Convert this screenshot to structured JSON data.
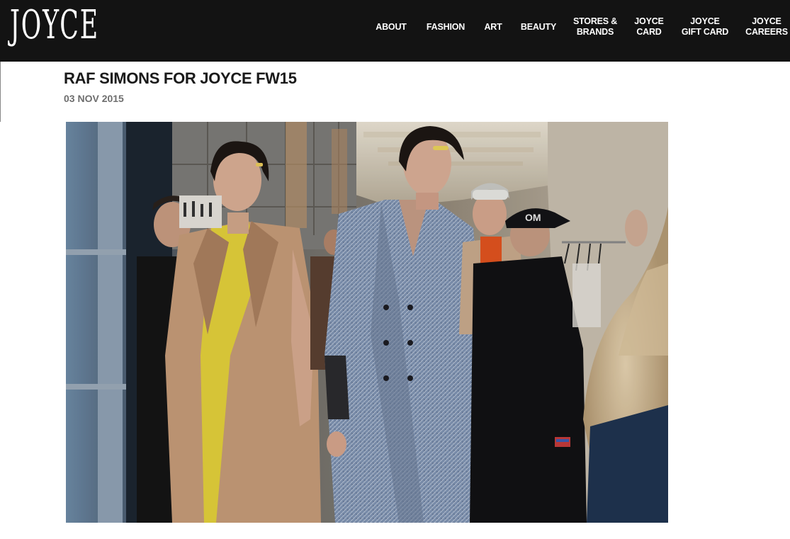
{
  "brand": {
    "logo_text": "JOYCE"
  },
  "nav": {
    "items": [
      {
        "label": "ABOUT"
      },
      {
        "label": "FASHION"
      },
      {
        "label": "ART"
      },
      {
        "label": "BEAUTY"
      },
      {
        "label": "STORES &\nBRANDS"
      },
      {
        "label": "JOYCE\nCARD"
      },
      {
        "label": "JOYCE\nGIFT CARD"
      },
      {
        "label": "JOYCE\nCAREERS"
      }
    ]
  },
  "article": {
    "title": "RAF SIMONS FOR JOYCE FW15",
    "date": "03 NOV 2015",
    "photo_subject": "backstage photo of models in coats"
  },
  "colors": {
    "header_bg": "#131313",
    "title": "#1a1a1a",
    "date": "#6e6e6e"
  }
}
